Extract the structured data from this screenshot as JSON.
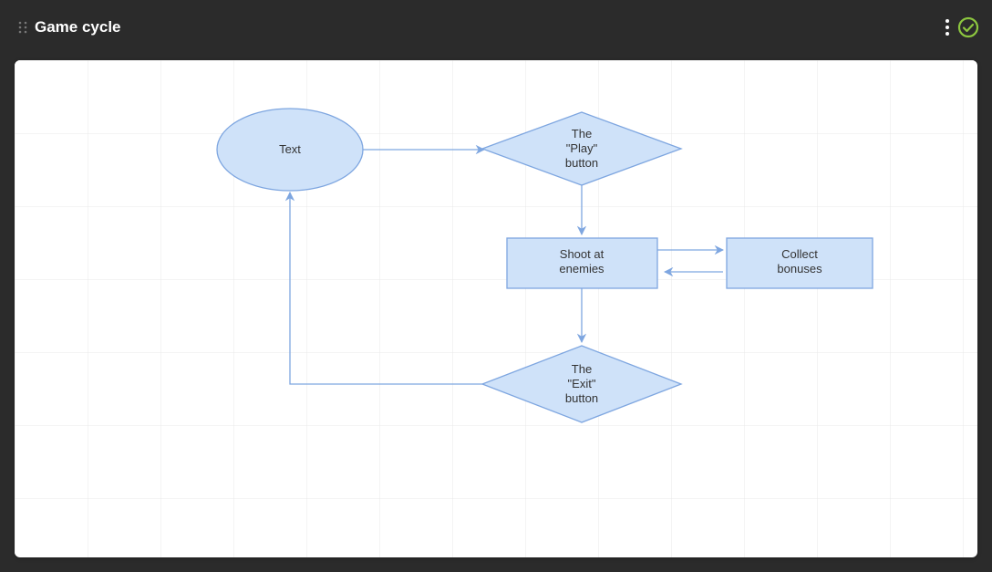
{
  "header": {
    "title": "Game cycle"
  },
  "nodes": {
    "start": {
      "label": "Text"
    },
    "play": {
      "line1": "The",
      "line2": "\"Play\"",
      "line3": "button"
    },
    "shoot": {
      "line1": "Shoot at",
      "line2": "enemies"
    },
    "collect": {
      "line1": "Collect",
      "line2": "bonuses"
    },
    "exit": {
      "line1": "The",
      "line2": "\"Exit\"",
      "line3": "button"
    }
  },
  "colors": {
    "nodeFill": "#cfe2f9",
    "nodeStroke": "#7ea6e0",
    "edge": "#7ea6e0",
    "grid": "#e8e8e8",
    "accent": "#8cc63f"
  }
}
